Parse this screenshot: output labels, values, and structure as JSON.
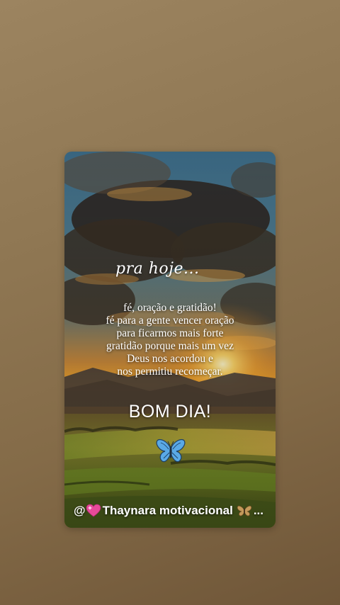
{
  "story": {
    "title_script": "pra hoje...",
    "message_lines": [
      "fé, oração e gratidão!",
      "fé para a gente vencer oração",
      "para ficarmos mais forte",
      "gratidão porque mais um vez",
      "Deus nos acordou e",
      "nos permitiu recomeçar."
    ],
    "greeting": "BOM DIA!",
    "signature_prefix": "@",
    "signature_name": "Thaynara motivacional",
    "signature_suffix": "...",
    "icons": {
      "heart": "sparkling-heart-icon",
      "butterfly": "butterfly-icon"
    }
  },
  "colors": {
    "background_top": "#9c8460",
    "background_bottom": "#6f5638",
    "text": "#ffffff",
    "butterfly_blue": "#5aa9e6"
  }
}
